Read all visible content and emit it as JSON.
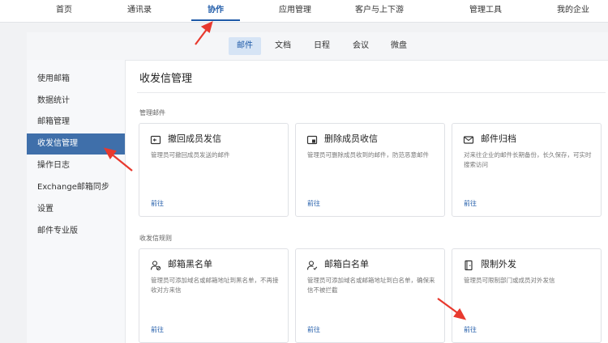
{
  "topnav": {
    "items": [
      "首页",
      "通讯录",
      "协作",
      "应用管理",
      "客户与上下游",
      "管理工具",
      "我的企业"
    ],
    "active_index": 2
  },
  "subtabs": {
    "items": [
      "邮件",
      "文档",
      "日程",
      "会议",
      "微盘"
    ],
    "active_index": 0
  },
  "sidebar": {
    "items": [
      "使用邮箱",
      "数据统计",
      "邮箱管理",
      "收发信管理",
      "操作日志",
      "Exchange邮箱同步",
      "设置",
      "邮件专业版"
    ],
    "active_index": 3
  },
  "main": {
    "title": "收发信管理",
    "sections": [
      {
        "label": "管理邮件",
        "cards": [
          {
            "icon": "recall-mail-icon",
            "title": "撤回成员发信",
            "desc": "管理员可撤回成员发送的邮件",
            "link": "前往"
          },
          {
            "icon": "delete-mail-icon",
            "title": "删除成员收信",
            "desc": "管理员可删除成员收到的邮件，防范恶意邮件",
            "link": "前往"
          },
          {
            "icon": "mail-archive-icon",
            "title": "邮件归档",
            "desc": "对来往企业的邮件长期备份，长久保存，可实时搜索访问",
            "link": "前往"
          }
        ]
      },
      {
        "label": "收发信规则",
        "cards": [
          {
            "icon": "blacklist-user-icon",
            "title": "邮箱黑名单",
            "desc": "管理员可添加域名或邮箱地址到黑名单，不再接收对方来信",
            "link": "前往"
          },
          {
            "icon": "whitelist-user-icon",
            "title": "邮箱白名单",
            "desc": "管理员可添加域名或邮箱地址到白名单，确保来信不被拦截",
            "link": "前往"
          },
          {
            "icon": "restrict-send-icon",
            "title": "限制外发",
            "desc": "管理员可限制部门或成员对外发信",
            "link": "前往"
          }
        ]
      }
    ]
  },
  "colors": {
    "accent": "#1e5aa8",
    "sidebar_active": "#3f6faa",
    "arrow": "#e8392e"
  }
}
